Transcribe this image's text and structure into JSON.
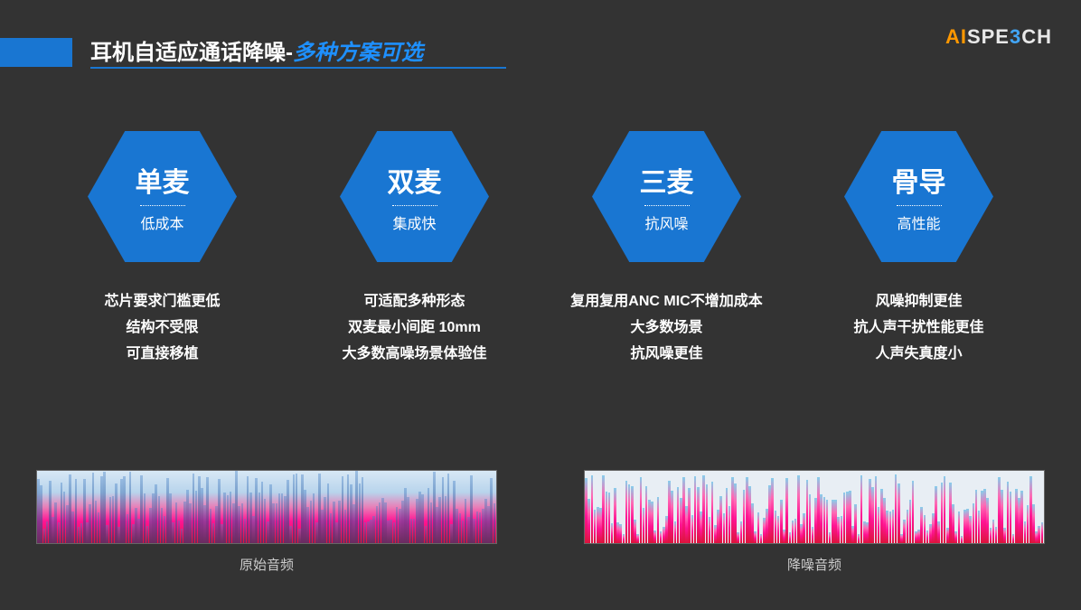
{
  "header": {
    "title_main": "耳机自适应通话降噪-",
    "title_sub": "多种方案可选"
  },
  "logo": {
    "part1": "AI",
    "part2": "SPE",
    "part3": "3",
    "part4": "CH"
  },
  "options": [
    {
      "title": "单麦",
      "subtitle": "低成本",
      "features": [
        "芯片要求门槛更低",
        "结构不受限",
        "可直接移植"
      ]
    },
    {
      "title": "双麦",
      "subtitle": "集成快",
      "features": [
        "可适配多种形态",
        "双麦最小间距 10mm",
        "大多数高噪场景体验佳"
      ]
    },
    {
      "title": "三麦",
      "subtitle": "抗风噪",
      "features": [
        "复用复用ANC MIC不增加成本",
        "大多数场景",
        "抗风噪更佳"
      ]
    },
    {
      "title": "骨导",
      "subtitle": "高性能",
      "features": [
        "风噪抑制更佳",
        "抗人声干扰性能更佳",
        "人声失真度小"
      ]
    }
  ],
  "spectrograms": {
    "original": "原始音频",
    "denoised": "降噪音频"
  }
}
